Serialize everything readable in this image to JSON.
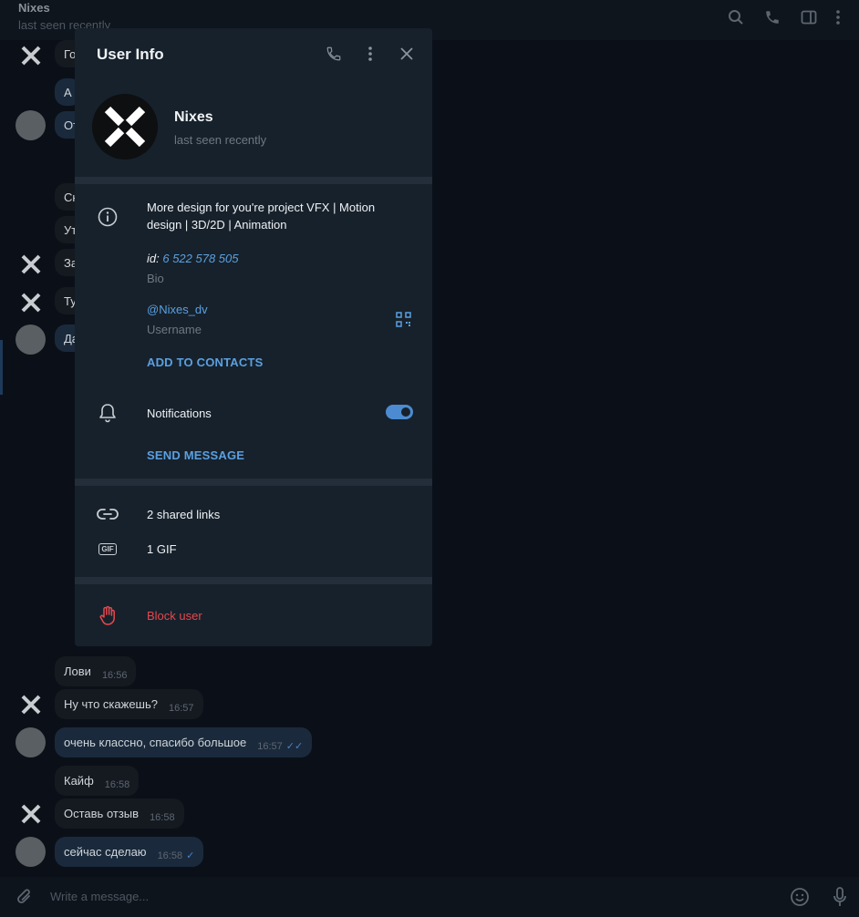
{
  "chat": {
    "title": "Nixes",
    "status": "last seen recently",
    "composer_placeholder": "Write a message...",
    "behind_snippets": [
      "Го",
      "А",
      "От",
      "Ск",
      "Ут",
      "За",
      "Ту",
      "Да"
    ],
    "messages": [
      {
        "text": "Лови",
        "time": "16:56",
        "direction": "in"
      },
      {
        "text": "Ну что скажешь?",
        "time": "16:57",
        "direction": "in"
      },
      {
        "text": "очень классно, спасибо большое",
        "time": "16:57",
        "direction": "out",
        "checks": "✓✓"
      },
      {
        "text": "Кайф",
        "time": "16:58",
        "direction": "in"
      },
      {
        "text": "Оставь отзыв",
        "time": "16:58",
        "direction": "in"
      },
      {
        "text": "сейчас сделаю",
        "time": "16:58",
        "direction": "out",
        "checks": "✓"
      }
    ]
  },
  "user_info": {
    "title": "User Info",
    "name": "Nixes",
    "status": "last seen recently",
    "bio": "More design for you're project VFX | Motion design | 3D/2D | Animation",
    "id_label": "id:",
    "id_value": "6 522 578 505",
    "bio_label": "Bio",
    "username": "@Nixes_dv",
    "username_label": "Username",
    "add_contacts": "ADD TO CONTACTS",
    "notifications": "Notifications",
    "notifications_on": true,
    "send_message": "SEND MESSAGE",
    "shared_links": "2 shared links",
    "gifs": "1 GIF",
    "gif_icon_text": "GIF",
    "block_user": "Block user"
  },
  "colors": {
    "accent": "#5aa0e0",
    "danger": "#e5484d",
    "panel": "#17212b",
    "background": "#0b1018"
  }
}
